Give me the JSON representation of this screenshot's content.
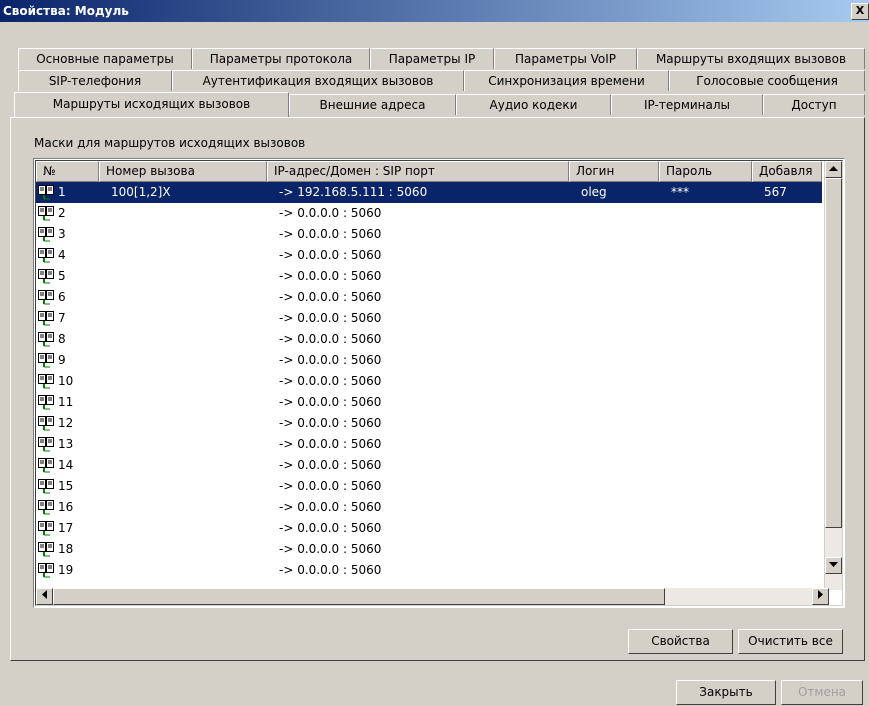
{
  "window": {
    "title": "Свойства: Модуль",
    "close_glyph": "X"
  },
  "tabs": {
    "row1": [
      "Основные параметры",
      "Параметры протокола",
      "Параметры IP",
      "Параметры VoIP",
      "Маршруты входящих вызовов"
    ],
    "row2": [
      "SIP-телефония",
      "Аутентификация входящих вызовов",
      "Синхронизация времени",
      "Голосовые сообщения"
    ],
    "row3": [
      "Маршруты исходящих вызовов",
      "Внешние адреса",
      "Аудио кодеки",
      "IP-терминалы",
      "Доступ"
    ],
    "active": "Маршруты исходящих вызовов"
  },
  "group_label": "Маски для маршрутов исходящих вызовов",
  "table": {
    "columns": [
      "№",
      "Номер вызова",
      "IP-адрес/Домен : SIP порт",
      "Логин",
      "Пароль",
      "Добавля"
    ],
    "rows": [
      [
        "1",
        "100[1,2]X",
        "-> 192.168.5.111 : 5060",
        "oleg",
        "***",
        "567"
      ],
      [
        "2",
        "",
        "-> 0.0.0.0 : 5060",
        "",
        "",
        ""
      ],
      [
        "3",
        "",
        "-> 0.0.0.0 : 5060",
        "",
        "",
        ""
      ],
      [
        "4",
        "",
        "-> 0.0.0.0 : 5060",
        "",
        "",
        ""
      ],
      [
        "5",
        "",
        "-> 0.0.0.0 : 5060",
        "",
        "",
        ""
      ],
      [
        "6",
        "",
        "-> 0.0.0.0 : 5060",
        "",
        "",
        ""
      ],
      [
        "7",
        "",
        "-> 0.0.0.0 : 5060",
        "",
        "",
        ""
      ],
      [
        "8",
        "",
        "-> 0.0.0.0 : 5060",
        "",
        "",
        ""
      ],
      [
        "9",
        "",
        "-> 0.0.0.0 : 5060",
        "",
        "",
        ""
      ],
      [
        "10",
        "",
        "-> 0.0.0.0 : 5060",
        "",
        "",
        ""
      ],
      [
        "11",
        "",
        "-> 0.0.0.0 : 5060",
        "",
        "",
        ""
      ],
      [
        "12",
        "",
        "-> 0.0.0.0 : 5060",
        "",
        "",
        ""
      ],
      [
        "13",
        "",
        "-> 0.0.0.0 : 5060",
        "",
        "",
        ""
      ],
      [
        "14",
        "",
        "-> 0.0.0.0 : 5060",
        "",
        "",
        ""
      ],
      [
        "15",
        "",
        "-> 0.0.0.0 : 5060",
        "",
        "",
        ""
      ],
      [
        "16",
        "",
        "-> 0.0.0.0 : 5060",
        "",
        "",
        ""
      ],
      [
        "17",
        "",
        "-> 0.0.0.0 : 5060",
        "",
        "",
        ""
      ],
      [
        "18",
        "",
        "-> 0.0.0.0 : 5060",
        "",
        "",
        ""
      ],
      [
        "19",
        "",
        "-> 0.0.0.0 : 5060",
        "",
        "",
        ""
      ]
    ],
    "selected_row": "1",
    "row_icon": "phone-book-icon"
  },
  "buttons": {
    "properties": "Свойства",
    "clear_all": "Очистить все",
    "close": "Закрыть",
    "cancel": "Отмена"
  },
  "colors": {
    "selection": "#0a246a",
    "dialog_bg": "#d4d0c8",
    "title_bar": "#0a246a"
  }
}
